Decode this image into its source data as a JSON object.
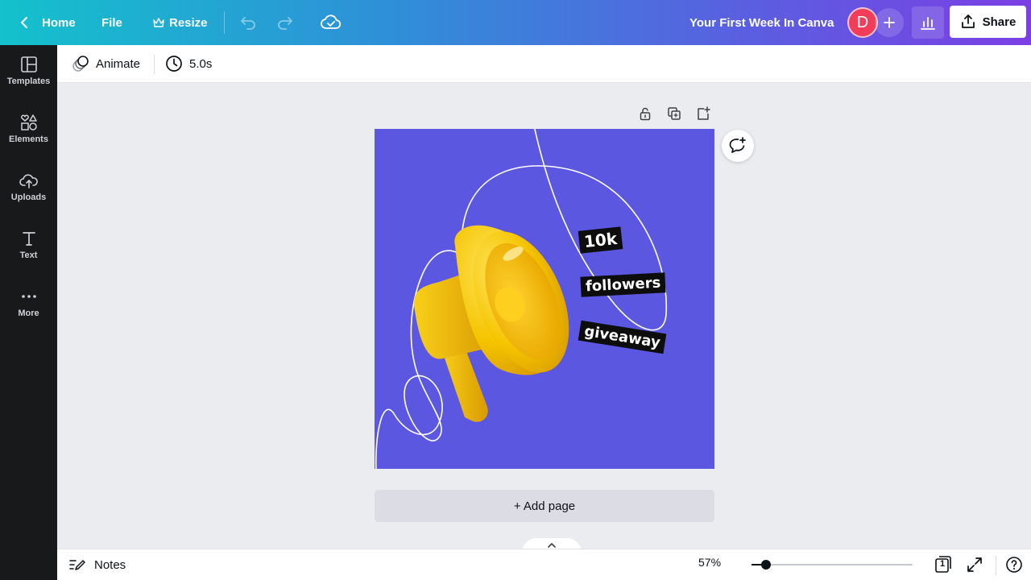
{
  "topbar": {
    "home_label": "Home",
    "file_label": "File",
    "resize_label": "Resize",
    "doc_title": "Your First Week In Canva",
    "avatar_initial": "D",
    "share_label": "Share",
    "add_icon": "plus-icon",
    "analytics_icon": "bar-chart-icon"
  },
  "sidebar": {
    "items": [
      {
        "label": "Templates",
        "icon": "templates-icon"
      },
      {
        "label": "Elements",
        "icon": "elements-icon"
      },
      {
        "label": "Uploads",
        "icon": "upload-cloud-icon"
      },
      {
        "label": "Text",
        "icon": "text-icon"
      },
      {
        "label": "More",
        "icon": "more-dots-icon"
      }
    ]
  },
  "subbar": {
    "animate_label": "Animate",
    "duration_label": "5.0s"
  },
  "design": {
    "background": "#5b57e0",
    "tags": [
      "10k",
      "followers",
      "giveaway"
    ]
  },
  "canvas": {
    "add_page_label": "+ Add page"
  },
  "bottombar": {
    "notes_label": "Notes",
    "zoom_label": "57%",
    "zoom_fraction": 0.09,
    "page_count": "1"
  },
  "colors": {
    "accent_avatar": "#f23d5a",
    "sidebar_bg": "#18191b",
    "canvas_bg": "#ebecf0"
  }
}
